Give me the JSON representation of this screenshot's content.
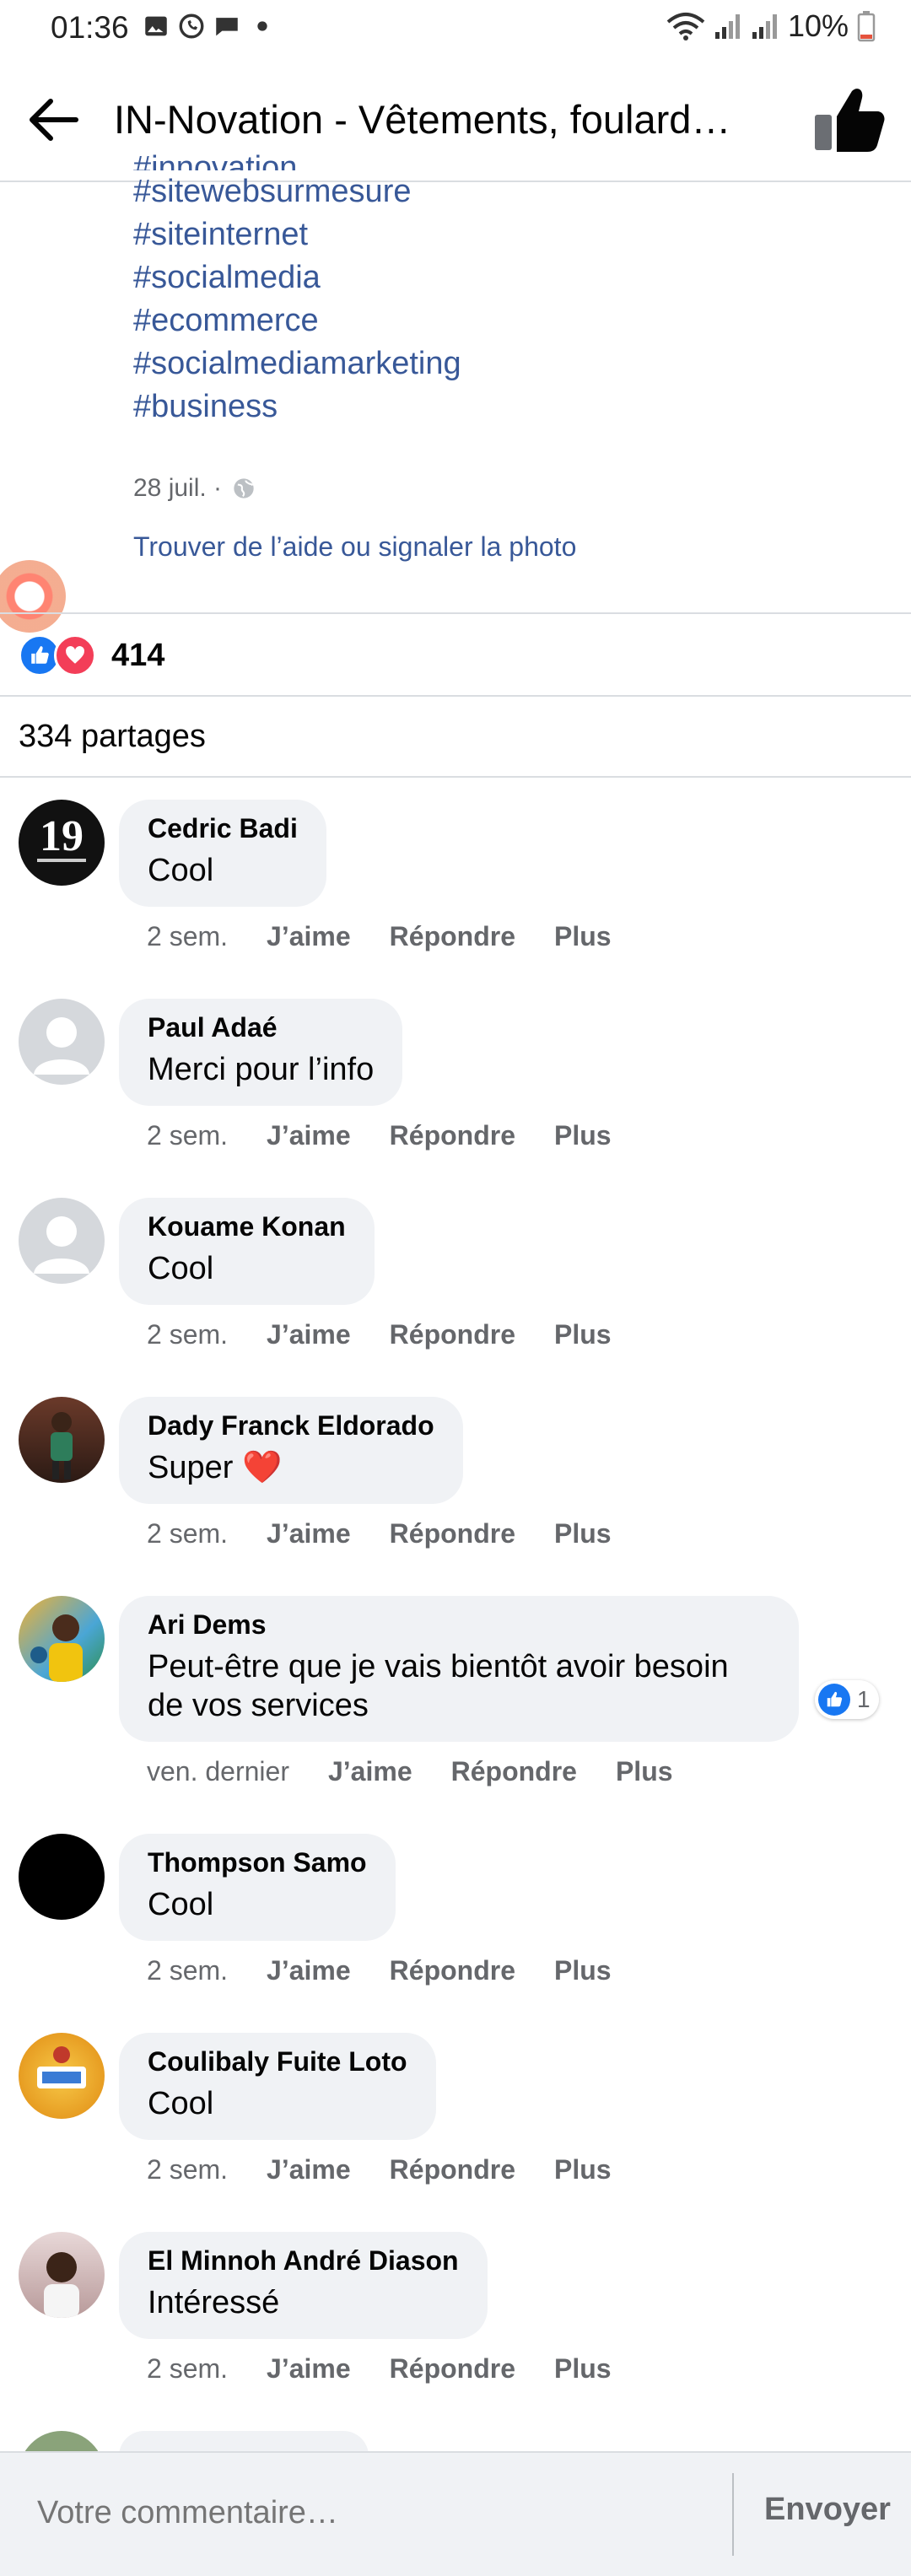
{
  "status_bar": {
    "time": "01:36",
    "battery": "10%"
  },
  "header": {
    "title": "IN-Novation - Vêtements, foulard…"
  },
  "post": {
    "partial_tag": "#innovation",
    "hashtags": [
      "#sitewebsurmesure",
      "#siteinternet",
      "#socialmedia",
      "#ecommerce",
      "#socialmediamarketing",
      "#business"
    ],
    "date": "28 juil. ·",
    "help_link": "Trouver de l’aide ou signaler la photo",
    "reaction_count": "414",
    "shares": "334 partages"
  },
  "actions_labels": {
    "like": "J’aime",
    "reply": "Répondre",
    "more": "Plus"
  },
  "comments": [
    {
      "name": "Cedric Badi",
      "text": "Cool",
      "time": "2 sem."
    },
    {
      "name": "Paul Adaé",
      "text": "Merci pour l’info",
      "time": "2 sem."
    },
    {
      "name": "Kouame Konan",
      "text": "Cool",
      "time": "2 sem."
    },
    {
      "name": "Dady Franck Eldorado",
      "text": "Super ❤️",
      "time": "2 sem."
    },
    {
      "name": "Ari Dems",
      "text": "Peut-être que je vais bientôt avoir besoin de vos services",
      "time": "ven. dernier",
      "reaction_count": "1"
    },
    {
      "name": "Thompson Samo",
      "text": "Cool",
      "time": "2 sem."
    },
    {
      "name": "Coulibaly Fuite Loto",
      "text": "Cool",
      "time": "2 sem."
    },
    {
      "name": "El Minnoh André Diason",
      "text": "Intéressé",
      "time": "2 sem."
    }
  ],
  "composer": {
    "placeholder": "Votre commentaire…",
    "send": "Envoyer"
  },
  "colors": {
    "link": "#385898",
    "like_blue": "#1877f2",
    "love_red": "#f33e58",
    "bubble_bg": "#f0f2f5",
    "muted": "#65676b"
  },
  "icons": [
    "back-arrow-icon",
    "thumbs-up-icon",
    "globe-icon",
    "like-reaction-icon",
    "love-reaction-icon",
    "wifi-icon",
    "signal-icon",
    "battery-icon"
  ]
}
